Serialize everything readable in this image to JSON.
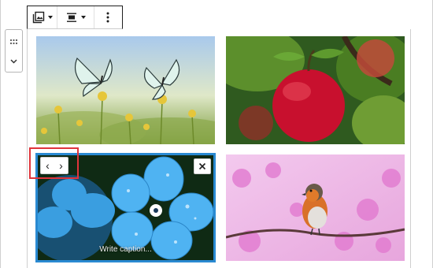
{
  "gallery": {
    "caption_placeholder": "Write caption...",
    "nav_prev": "‹",
    "nav_next": "›",
    "remove_label": "×",
    "images": [
      {
        "subject": "butterflies on meadow flowers"
      },
      {
        "subject": "red apple on tree branch"
      },
      {
        "subject": "blue forget-me-not flowers with raindrops"
      },
      {
        "subject": "robin on pink blossom branch"
      }
    ]
  },
  "toolbar": {
    "icons": [
      "image-gallery-icon",
      "align-icon",
      "more-options-icon"
    ]
  },
  "colors": {
    "selection": "#2a8ad2",
    "highlight": "#e0343b"
  }
}
